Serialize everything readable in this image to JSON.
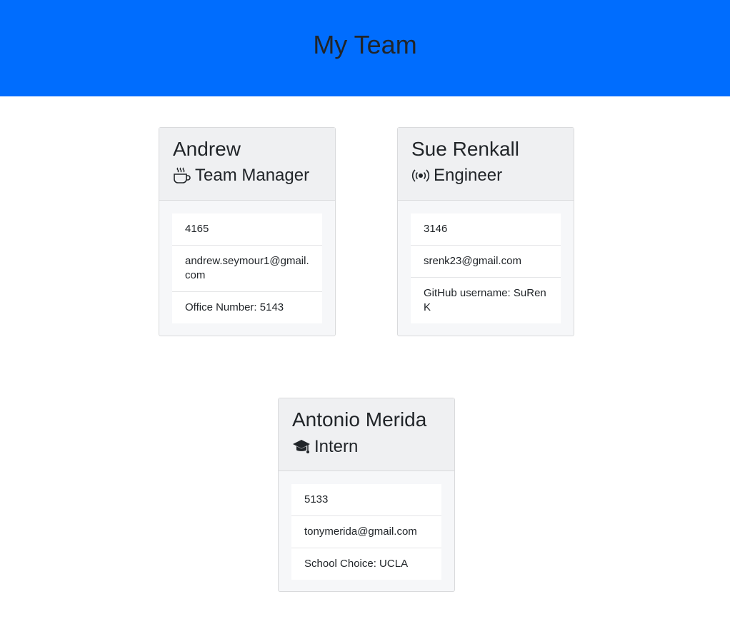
{
  "header": {
    "title": "My Team"
  },
  "cards": [
    {
      "name": "Andrew",
      "role": "Team Manager",
      "role_icon": "coffee-icon",
      "id": "4165",
      "email": "andrew.seymour1@gmail.com",
      "extra": "Office Number: 5143"
    },
    {
      "name": "Sue Renkall",
      "role": "Engineer",
      "role_icon": "broadcast-icon",
      "id": "3146",
      "email": "srenk23@gmail.com",
      "extra": "GitHub username: SuRenK"
    },
    {
      "name": "Antonio Merida",
      "role": "Intern",
      "role_icon": "graduation-cap-icon",
      "id": "5133",
      "email": "tonymerida@gmail.com",
      "extra": "School Choice: UCLA"
    }
  ],
  "colors": {
    "header_bg": "#006dfe",
    "card_bg": "#f6f7f9",
    "card_head_bg": "#eff0f2"
  }
}
